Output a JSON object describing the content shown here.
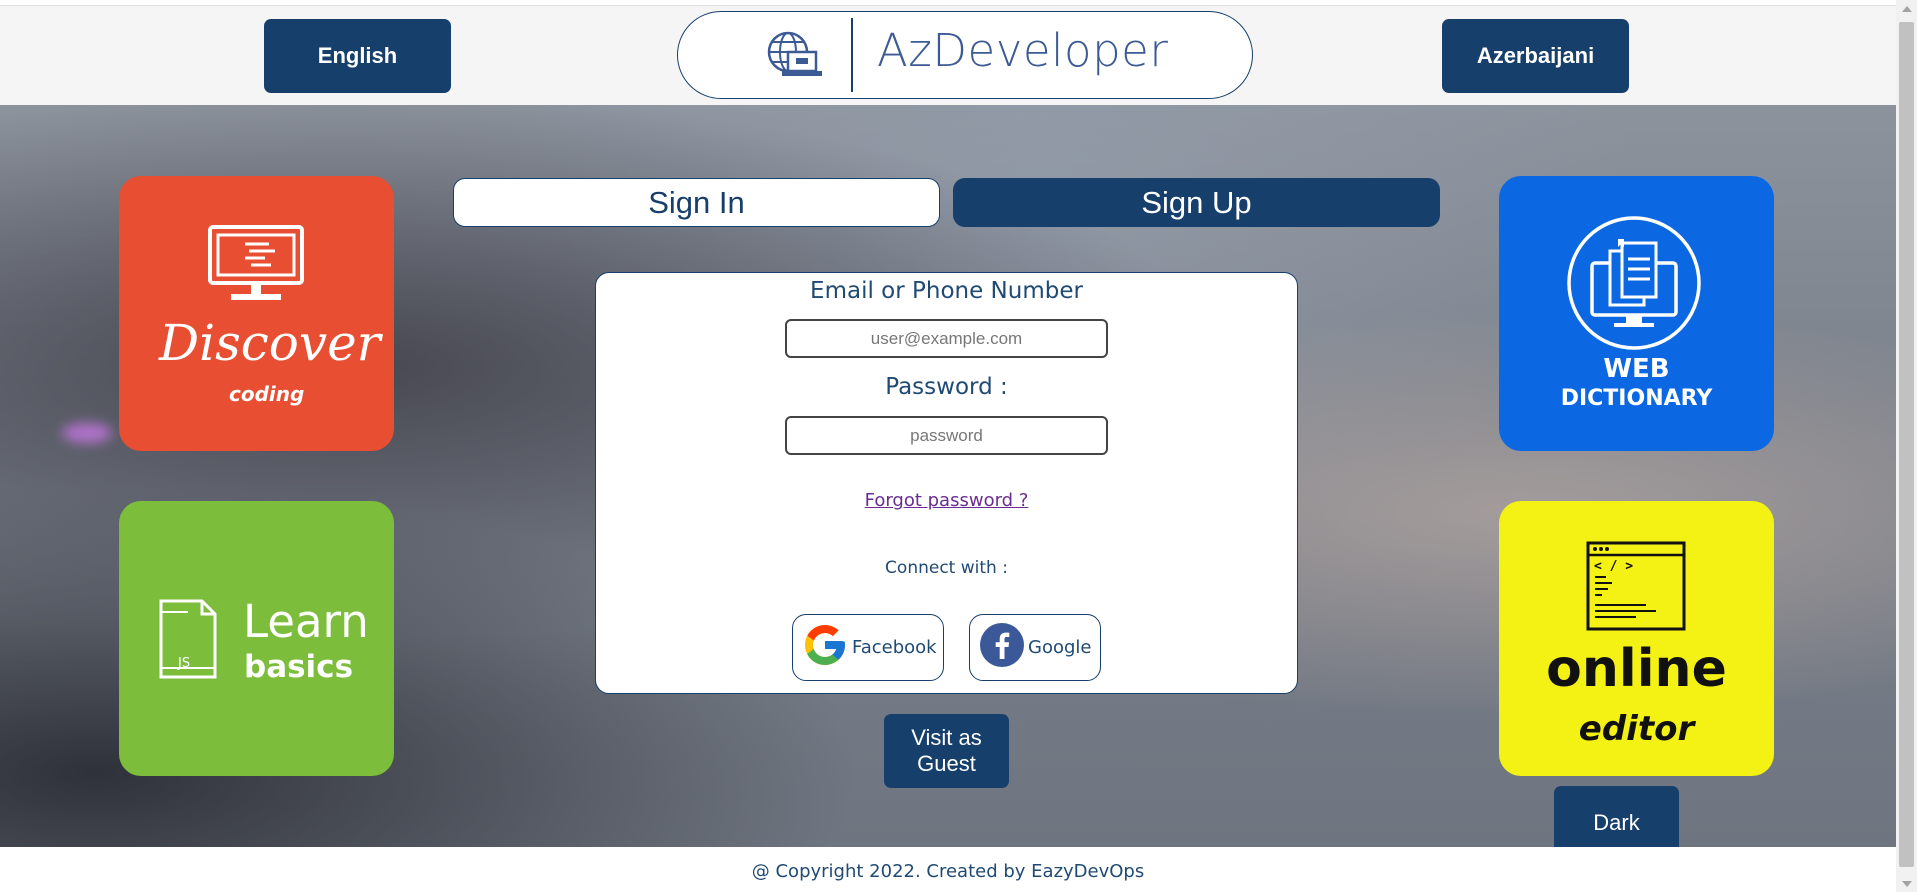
{
  "header": {
    "lang_en": "English",
    "lang_az": "Azerbaijani",
    "logo_text": "AzDeveloper"
  },
  "tiles": {
    "discover": {
      "title": "Discover",
      "subtitle": "coding"
    },
    "learn": {
      "title": "Learn",
      "subtitle": "basics",
      "file_label": "JS"
    },
    "dictionary": {
      "title_line1": "WEB",
      "title_line2": "DICTIONARY"
    },
    "editor": {
      "title": "online",
      "subtitle": "editor",
      "code_label": "< / >"
    }
  },
  "tabs": {
    "signin": "Sign In",
    "signup": "Sign Up"
  },
  "form": {
    "email_label": "Email or Phone Number",
    "email_placeholder": "user@example.com",
    "password_label": "Password :",
    "password_placeholder": "password",
    "forgot": "Forgot password ?",
    "connect": "Connect with :",
    "social_fb": "Facebook",
    "social_google": "Google"
  },
  "guest_label": "Visit as Guest",
  "dark_label": "Dark",
  "footer": "@ Copyright 2022. Created by EazyDevOps",
  "colors": {
    "primary": "#173f6c",
    "discover": "#e84e32",
    "learn": "#7cbd3b",
    "dictionary": "#0b68e2",
    "editor": "#f4f115"
  },
  "icons": [
    "globe-laptop-icon",
    "monitor-icon",
    "js-file-icon",
    "book-monitor-icon",
    "code-window-icon",
    "google-icon",
    "facebook-icon"
  ]
}
